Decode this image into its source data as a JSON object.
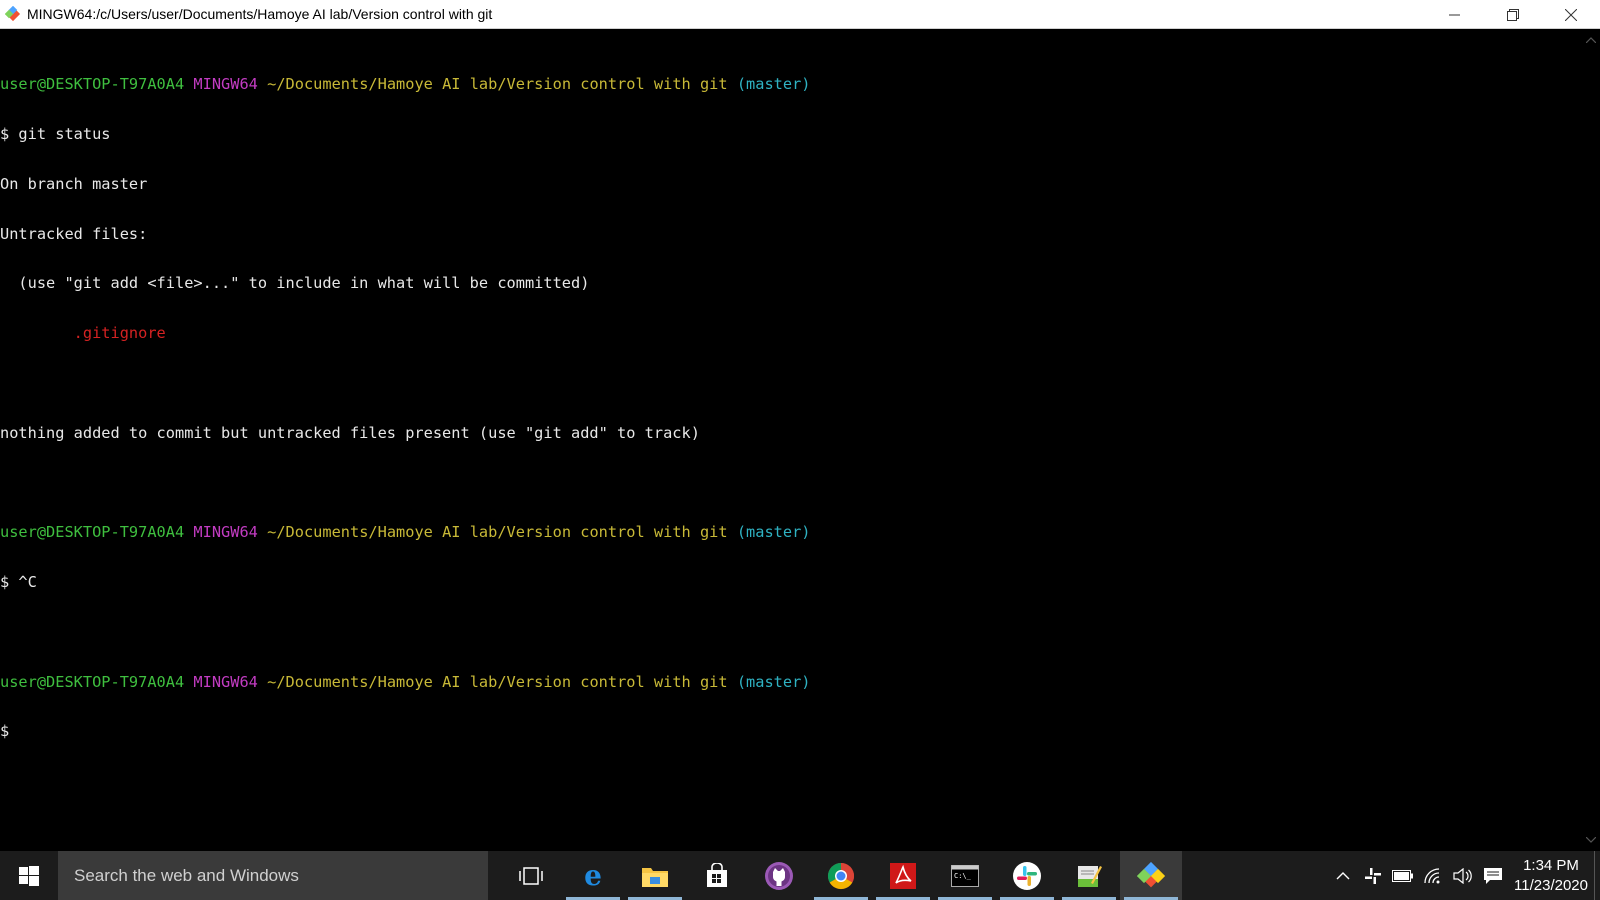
{
  "window": {
    "title": "MINGW64:/c/Users/user/Documents/Hamoye AI lab/Version control with git"
  },
  "terminal": {
    "prompt": {
      "user_host": "user@DESKTOP-T97A0A4",
      "system": "MINGW64",
      "path": "~/Documents/Hamoye AI lab/Version control with git",
      "branch": "(master)"
    },
    "lines": {
      "cmd1": "$ git status",
      "out1": "On branch master",
      "out2": "Untracked files:",
      "out3": "  (use \"git add <file>...\" to include in what will be committed)",
      "untracked_file": "        .gitignore",
      "out4": "nothing added to commit but untracked files present (use \"git add\" to track)",
      "cmd2": "$ ^C",
      "cmd3": "$"
    }
  },
  "taskbar": {
    "search_placeholder": "Search the web and Windows",
    "apps": [
      {
        "name": "Task View",
        "icon": "task-view-icon"
      },
      {
        "name": "Microsoft Edge",
        "icon": "edge-icon"
      },
      {
        "name": "File Explorer",
        "icon": "folder-icon"
      },
      {
        "name": "Store",
        "icon": "store-icon"
      },
      {
        "name": "GitHub Desktop",
        "icon": "github-icon"
      },
      {
        "name": "Google Chrome",
        "icon": "chrome-icon"
      },
      {
        "name": "Adobe Reader",
        "icon": "acrobat-icon"
      },
      {
        "name": "Command Prompt",
        "icon": "cmd-icon"
      },
      {
        "name": "Slack",
        "icon": "slack-icon"
      },
      {
        "name": "Editor",
        "icon": "notepad-icon"
      },
      {
        "name": "Git Bash",
        "icon": "git-icon"
      }
    ],
    "clock": {
      "time": "1:34 PM",
      "date": "11/23/2020"
    }
  }
}
